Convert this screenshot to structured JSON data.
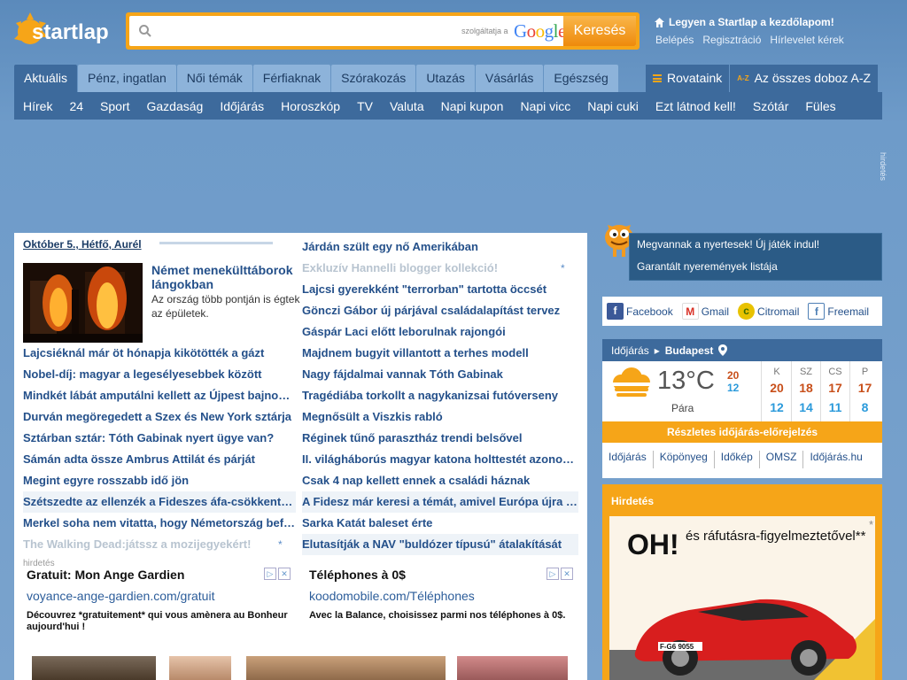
{
  "header": {
    "logo_text": "startlap",
    "search": {
      "placeholder": "",
      "served_by": "szolgáltatja a",
      "provider": "Google",
      "button": "Keresés"
    },
    "home_link": "Legyen a Startlap a kezdőlapom!",
    "account_links": [
      "Belépés",
      "Regisztráció",
      "Hírlevelet kérek"
    ]
  },
  "nav": {
    "tabs": [
      "Aktuális",
      "Pénz, ingatlan",
      "Női témák",
      "Férfiaknak",
      "Szórakozás",
      "Utazás",
      "Vásárlás",
      "Egészség"
    ],
    "active_tab": "Aktuális",
    "right": {
      "sections": "Rovataink",
      "az_badge": "A-Z",
      "all_boxes": "Az összes doboz A-Z"
    },
    "subnav": [
      "Hírek",
      "24",
      "Sport",
      "Gazdaság",
      "Időjárás",
      "Horoszkóp",
      "TV",
      "Valuta",
      "Napi kupon",
      "Napi vicc",
      "Napi cuki",
      "Ezt látnod kell!",
      "Szótár",
      "Füles"
    ],
    "side_ad_label": "hirdetés"
  },
  "news": {
    "date": "Október 5., Hétfő, Aurél",
    "featured": {
      "title": "Német menekülttáborok lángokban",
      "lead": "Az ország több pontján is égtek az épületek."
    },
    "left_items": [
      {
        "text": "Lajcsiéknál már öt hónapja kikötötték a gázt",
        "kind": "normal"
      },
      {
        "text": "Nobel-díj: magyar a legesélyesebbek között",
        "kind": "normal"
      },
      {
        "text": "Mindkét lábát amputálni kellett az Újpest bajnokának",
        "kind": "normal"
      },
      {
        "text": "Durván megöregedett a Szex és New York sztárja",
        "kind": "normal"
      },
      {
        "text": "Sztárban sztár: Tóth Gabinak nyert ügye van?",
        "kind": "normal"
      },
      {
        "text": "Sámán adta össze Ambrus Attilát és párját",
        "kind": "normal"
      },
      {
        "text": "Megint egyre rosszabb idő jön",
        "kind": "normal"
      },
      {
        "text": "Szétszedte az ellenzék a Fideszes áfa-csökkentést",
        "kind": "alt"
      },
      {
        "text": "Merkel soha nem vitatta, hogy Németország befogadja",
        "kind": "normal"
      },
      {
        "text": "The Walking Dead:játssz a mozijegyekért!",
        "kind": "promo"
      }
    ],
    "right_items": [
      {
        "text": "Járdán szült egy nő Amerikában",
        "kind": "normal"
      },
      {
        "text": "Exkluzív Hannelli blogger kollekció!",
        "kind": "promo"
      },
      {
        "text": "Lajcsi gyerekként \"terrorban\" tartotta öccsét",
        "kind": "normal"
      },
      {
        "text": "Gönczi Gábor új párjával családalapítást tervez",
        "kind": "normal"
      },
      {
        "text": "Gáspár Laci előtt leborulnak rajongói",
        "kind": "normal"
      },
      {
        "text": "Majdnem bugyit villantott a terhes modell",
        "kind": "normal"
      },
      {
        "text": "Nagy fájdalmai vannak Tóth Gabinak",
        "kind": "normal"
      },
      {
        "text": "Tragédiába torkollt a nagykanizsai futóverseny",
        "kind": "normal"
      },
      {
        "text": "Megnősült a Viszkis rabló",
        "kind": "normal"
      },
      {
        "text": "Réginek tűnő parasztház trendi belsővel",
        "kind": "normal"
      },
      {
        "text": "II. világháborús magyar katona holttestét azonosították",
        "kind": "normal"
      },
      {
        "text": "Csak 4 nap kellett ennek a családi háznak",
        "kind": "normal"
      },
      {
        "text": "A Fidesz már keresi a témát, amivel Európa újra bekeményít",
        "kind": "alt"
      },
      {
        "text": "Sarka Katát baleset érte",
        "kind": "normal"
      },
      {
        "text": "Elutasítják a NAV \"buldózer típusú\" átalakítását",
        "kind": "alt"
      }
    ],
    "star_glyph": "*",
    "ad_label": "hirdetés",
    "ads": [
      {
        "title": "Gratuit: Mon Ange Gardien",
        "url": "voyance-ange-gardien.com/gratuit",
        "desc": "Découvrez *gratuitement* qui vous amènera au Bonheur aujourd'hui !"
      },
      {
        "title": "Téléphones à 0$",
        "url": "koodomobile.com/Téléphones",
        "desc": "Avec la Balance, choisissez parmi nos téléphones à 0$."
      }
    ]
  },
  "sidebar": {
    "game": [
      "Megvannak a nyertesek! Új játék indul!",
      "Garantált nyeremények listája"
    ],
    "mail": [
      {
        "label": "Facebook",
        "icon": "facebook-icon",
        "color": "#3b5998",
        "glyph": "f"
      },
      {
        "label": "Gmail",
        "icon": "gmail-icon",
        "color": "#d93025",
        "glyph": "M"
      },
      {
        "label": "Citromail",
        "icon": "citromail-icon",
        "color": "#e8c200",
        "glyph": "c"
      },
      {
        "label": "Freemail",
        "icon": "freemail-icon",
        "color": "#4e7fb5",
        "glyph": "f"
      }
    ],
    "weather": {
      "title": "Időjárás",
      "city": "Budapest",
      "temp": "13°C",
      "hi": "20",
      "lo": "12",
      "condition": "Pára",
      "days": [
        {
          "name": "K",
          "hi": "20",
          "lo": "12"
        },
        {
          "name": "SZ",
          "hi": "18",
          "lo": "14"
        },
        {
          "name": "CS",
          "hi": "17",
          "lo": "11"
        },
        {
          "name": "P",
          "hi": "17",
          "lo": "8"
        }
      ],
      "detail_button": "Részletes időjárás-előrejelzés",
      "links": [
        "Időjárás",
        "Köpönyeg",
        "Időkép",
        "OMSZ",
        "Időjárás.hu"
      ]
    },
    "ad": {
      "label": "Hirdetés",
      "headline": "OH!",
      "slogan": "és ráfutásra-figyelmeztetővel**",
      "plate": "F-G6 9055",
      "corner": "*"
    }
  },
  "colors": {
    "accent": "#f6a518",
    "nav": "#3d6a9c",
    "link": "#24508a"
  }
}
